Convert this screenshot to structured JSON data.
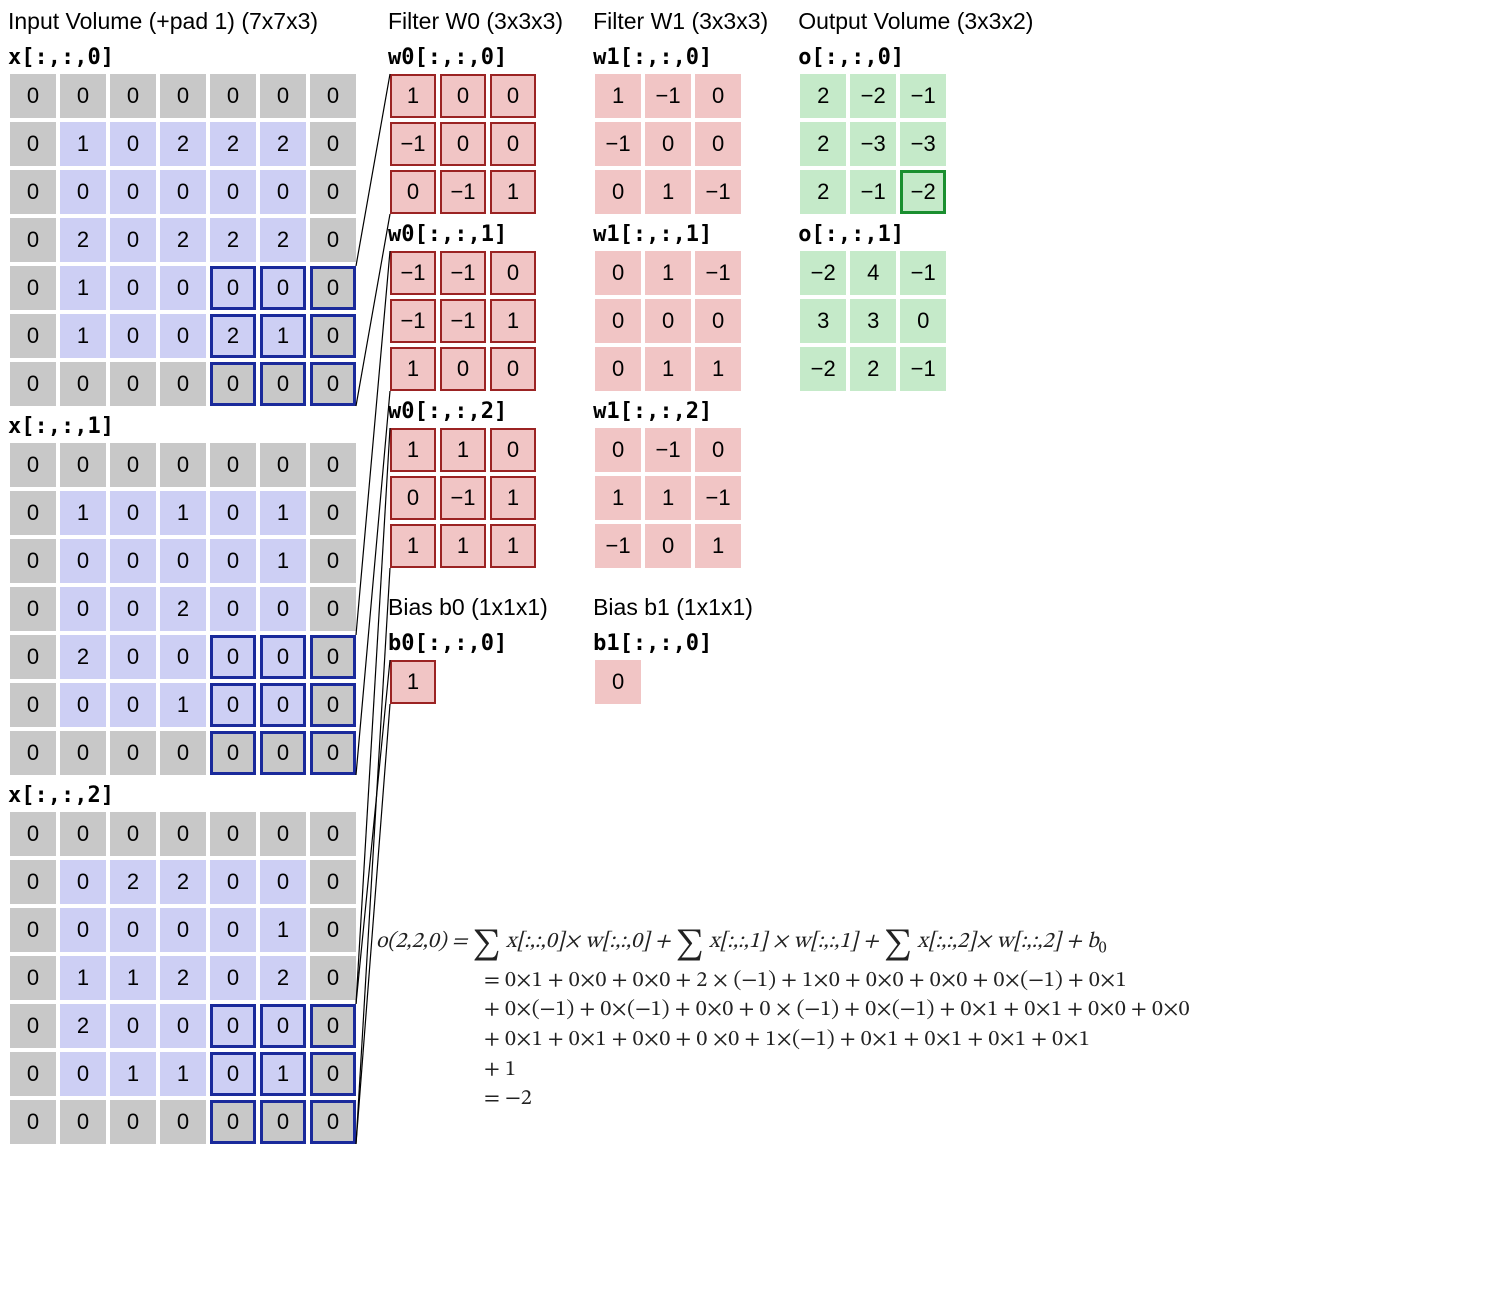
{
  "headings": {
    "input": "Input Volume (+pad 1) (7x7x3)",
    "w0": "Filter W0 (3x3x3)",
    "w1": "Filter W1 (3x3x3)",
    "out": "Output Volume (3x3x2)",
    "b0": "Bias b0 (1x1x1)",
    "b1": "Bias b1 (1x1x1)"
  },
  "labels": {
    "x0": "x[:,:,0]",
    "x1": "x[:,:,1]",
    "x2": "x[:,:,2]",
    "w00": "w0[:,:,0]",
    "w01": "w0[:,:,1]",
    "w02": "w0[:,:,2]",
    "w10": "w1[:,:,0]",
    "w11": "w1[:,:,1]",
    "w12": "w1[:,:,2]",
    "o0": "o[:,:,0]",
    "o1": "o[:,:,1]",
    "b0": "b0[:,:,0]",
    "b1": "b1[:,:,0]"
  },
  "input": {
    "slices": [
      [
        [
          0,
          0,
          0,
          0,
          0,
          0,
          0
        ],
        [
          0,
          1,
          0,
          2,
          2,
          2,
          0
        ],
        [
          0,
          0,
          0,
          0,
          0,
          0,
          0
        ],
        [
          0,
          2,
          0,
          2,
          2,
          2,
          0
        ],
        [
          0,
          1,
          0,
          0,
          0,
          0,
          0
        ],
        [
          0,
          1,
          0,
          0,
          2,
          1,
          0
        ],
        [
          0,
          0,
          0,
          0,
          0,
          0,
          0
        ]
      ],
      [
        [
          0,
          0,
          0,
          0,
          0,
          0,
          0
        ],
        [
          0,
          1,
          0,
          1,
          0,
          1,
          0
        ],
        [
          0,
          0,
          0,
          0,
          0,
          1,
          0
        ],
        [
          0,
          0,
          0,
          2,
          0,
          0,
          0
        ],
        [
          0,
          2,
          0,
          0,
          0,
          0,
          0
        ],
        [
          0,
          0,
          0,
          1,
          0,
          0,
          0
        ],
        [
          0,
          0,
          0,
          0,
          0,
          0,
          0
        ]
      ],
      [
        [
          0,
          0,
          0,
          0,
          0,
          0,
          0
        ],
        [
          0,
          0,
          2,
          2,
          0,
          0,
          0
        ],
        [
          0,
          0,
          0,
          0,
          0,
          1,
          0
        ],
        [
          0,
          1,
          1,
          2,
          0,
          2,
          0
        ],
        [
          0,
          2,
          0,
          0,
          0,
          0,
          0
        ],
        [
          0,
          0,
          1,
          1,
          0,
          1,
          0
        ],
        [
          0,
          0,
          0,
          0,
          0,
          0,
          0
        ]
      ]
    ],
    "highlight": {
      "rowStart": 4,
      "colStart": 4
    }
  },
  "w0": {
    "slices": [
      [
        [
          1,
          0,
          0
        ],
        [
          -1,
          0,
          0
        ],
        [
          0,
          -1,
          1
        ]
      ],
      [
        [
          -1,
          -1,
          0
        ],
        [
          -1,
          -1,
          1
        ],
        [
          1,
          0,
          0
        ]
      ],
      [
        [
          1,
          1,
          0
        ],
        [
          0,
          -1,
          1
        ],
        [
          1,
          1,
          1
        ]
      ]
    ]
  },
  "w1": {
    "slices": [
      [
        [
          1,
          -1,
          0
        ],
        [
          -1,
          0,
          0
        ],
        [
          0,
          1,
          -1
        ]
      ],
      [
        [
          0,
          1,
          -1
        ],
        [
          0,
          0,
          0
        ],
        [
          0,
          1,
          1
        ]
      ],
      [
        [
          0,
          -1,
          0
        ],
        [
          1,
          1,
          -1
        ],
        [
          -1,
          0,
          1
        ]
      ]
    ]
  },
  "b0": 1,
  "b1": 0,
  "output": {
    "slices": [
      [
        [
          2,
          -2,
          -1
        ],
        [
          2,
          -3,
          -3
        ],
        [
          2,
          -1,
          -2
        ]
      ],
      [
        [
          -2,
          4,
          -1
        ],
        [
          3,
          3,
          0
        ],
        [
          -2,
          2,
          -1
        ]
      ]
    ],
    "highlight": {
      "slice": 0,
      "row": 2,
      "col": 2
    }
  },
  "equation": {
    "line1_left": "o(2,2,0) = ",
    "line1_right": "x[:,:,0]× w[:,:,0] + ",
    "line1_right2": "x[:,:,1] × w[:,:,1] + ",
    "line1_right3": "x[:,:,2]× w[:,:,2] + b",
    "line2": "=  0×1 + 0×0 + 0×0  + 2 × (−1) + 1×0 + 0×0 +  0×0 + 0×(−1) + 0×1",
    "line3": "+ 0×(−1) + 0×(−1) + 0×0  + 0 × (−1) + 0×(−1) + 0×1 +  0×1 + 0×0 + 0×0",
    "line4": "+ 0×1 + 0×1 + 0×0  + 0 ×0  + 1×(−1) + 0×1 +  0×1 + 0×1 + 0×1",
    "line5": "+ 1",
    "line6": "=  −2"
  }
}
